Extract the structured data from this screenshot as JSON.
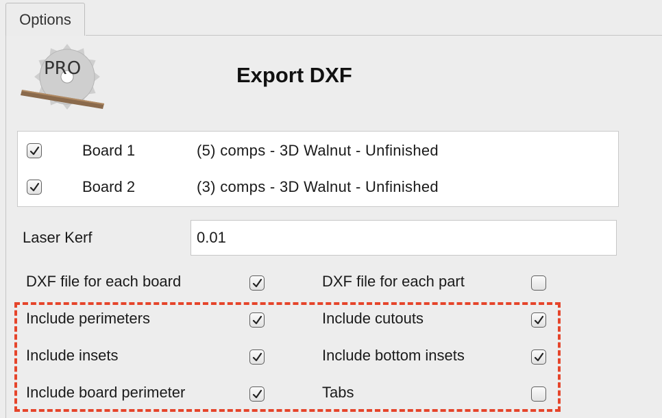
{
  "tab": {
    "label": "Options"
  },
  "header": {
    "title": "Export DXF",
    "logo_text": "PRO"
  },
  "boards": [
    {
      "name": "Board 1",
      "description": "(5) comps - 3D Walnut - Unfinished",
      "checked": true
    },
    {
      "name": "Board 2",
      "description": "(3) comps - 3D Walnut - Unfinished",
      "checked": true
    }
  ],
  "laser_kerf": {
    "label": "Laser Kerf",
    "value": "0.01"
  },
  "options": [
    {
      "left": {
        "label": "DXF file for each board",
        "checked": true
      },
      "right": {
        "label": "DXF file for each part",
        "checked": false
      }
    },
    {
      "left": {
        "label": "Include perimeters",
        "checked": true
      },
      "right": {
        "label": "Include cutouts",
        "checked": true
      }
    },
    {
      "left": {
        "label": "Include insets",
        "checked": true
      },
      "right": {
        "label": "Include bottom insets",
        "checked": true
      }
    },
    {
      "left": {
        "label": "Include board perimeter",
        "checked": true
      },
      "right": {
        "label": "Tabs",
        "checked": false
      }
    }
  ],
  "colors": {
    "highlight_dash": "#e5452b",
    "panel_bg": "#ededed"
  }
}
